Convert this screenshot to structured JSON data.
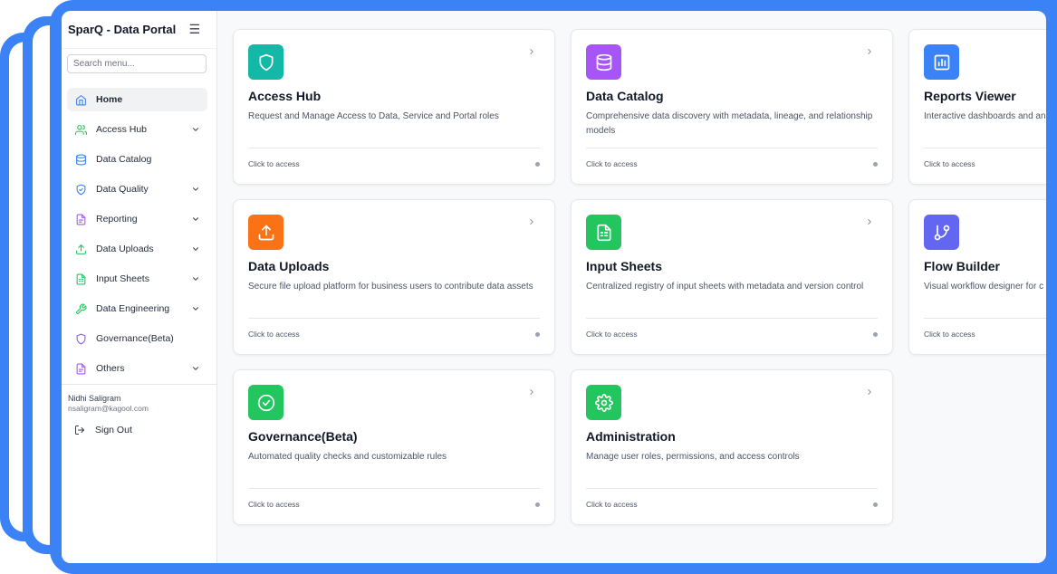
{
  "app": {
    "title": "SparQ - Data Portal"
  },
  "search": {
    "placeholder": "Search menu..."
  },
  "colors": {
    "frame_blue": "#3b82f6",
    "teal": "#14b8a6",
    "purple": "#a855f7",
    "blue": "#3b82f6",
    "orange": "#f97316",
    "green": "#22c55e",
    "indigo": "#6366f1"
  },
  "sidebar": {
    "items": [
      {
        "label": "Home",
        "icon": "home-icon",
        "expandable": false,
        "active": true
      },
      {
        "label": "Access Hub",
        "icon": "users-icon",
        "expandable": true
      },
      {
        "label": "Data Catalog",
        "icon": "database-icon",
        "expandable": false
      },
      {
        "label": "Data Quality",
        "icon": "shield-check-icon",
        "expandable": true
      },
      {
        "label": "Reporting",
        "icon": "file-icon",
        "expandable": true
      },
      {
        "label": "Data Uploads",
        "icon": "upload-icon",
        "expandable": true
      },
      {
        "label": "Input Sheets",
        "icon": "sheet-icon",
        "expandable": true
      },
      {
        "label": "Data Engineering",
        "icon": "wrench-icon",
        "expandable": true
      },
      {
        "label": "Governance(Beta)",
        "icon": "shield-icon",
        "expandable": false
      },
      {
        "label": "Others",
        "icon": "file-icon",
        "expandable": true
      }
    ]
  },
  "user": {
    "name": "Nidhi Saligram",
    "email": "nsaligram@kagool.com"
  },
  "signout": {
    "label": "Sign Out"
  },
  "cards": [
    {
      "title": "Access Hub",
      "desc": "Request and Manage Access to Data, Service and Portal roles",
      "cta": "Click to access",
      "icon": "shield-icon",
      "color": "#14b8a6"
    },
    {
      "title": "Data Catalog",
      "desc": "Comprehensive data discovery with metadata, lineage, and relationship models",
      "cta": "Click to access",
      "icon": "database-icon",
      "color": "#a855f7"
    },
    {
      "title": "Reports Viewer",
      "desc": "Interactive dashboards and ana",
      "cta": "Click to access",
      "icon": "bar-chart-icon",
      "color": "#3b82f6"
    },
    {
      "title": "Data Uploads",
      "desc": "Secure file upload platform for business users to contribute data assets",
      "cta": "Click to access",
      "icon": "upload-icon",
      "color": "#f97316"
    },
    {
      "title": "Input Sheets",
      "desc": "Centralized registry of input sheets with metadata and version control",
      "cta": "Click to access",
      "icon": "sheet-icon",
      "color": "#22c55e"
    },
    {
      "title": "Flow Builder",
      "desc": "Visual workflow designer for c pipelines",
      "cta": "Click to access",
      "icon": "git-branch-icon",
      "color": "#6366f1"
    },
    {
      "title": "Governance(Beta)",
      "desc": "Automated quality checks and customizable rules",
      "cta": "Click to access",
      "icon": "check-circle-icon",
      "color": "#22c55e"
    },
    {
      "title": "Administration",
      "desc": "Manage user roles, permissions, and access controls",
      "cta": "Click to access",
      "icon": "gear-icon",
      "color": "#22c55e"
    }
  ]
}
